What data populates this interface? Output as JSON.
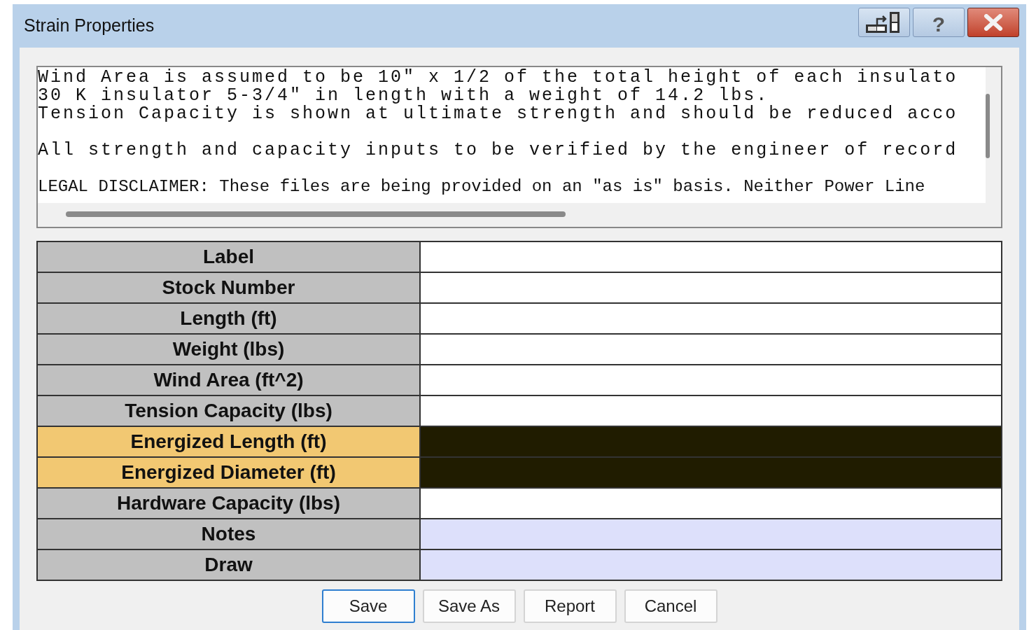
{
  "window": {
    "title": "Strain Properties",
    "help_button": "?"
  },
  "notes": {
    "paragraphs": [
      [
        "Wind Area is assumed to be 10\" x 1/2 of the total height of each insulato",
        "30 K insulator 5-3/4\" in length with a weight of 14.2 lbs.",
        "Tension Capacity is shown at ultimate strength and should be reduced acco"
      ],
      [
        "All strength and capacity inputs to be verified by the engineer of record"
      ],
      [
        "LEGAL DISCLAIMER: These files are being provided on an \"as is\" basis. Neither Power Line"
      ]
    ]
  },
  "properties": [
    {
      "label": "Label",
      "kind": "normal"
    },
    {
      "label": "Stock Number",
      "kind": "normal"
    },
    {
      "label": "Length (ft)",
      "kind": "normal"
    },
    {
      "label": "Weight (lbs)",
      "kind": "normal"
    },
    {
      "label": "Wind Area (ft^2)",
      "kind": "normal"
    },
    {
      "label": "Tension Capacity (lbs)",
      "kind": "normal"
    },
    {
      "label": "Energized Length (ft)",
      "kind": "energized"
    },
    {
      "label": "Energized Diameter (ft)",
      "kind": "energized"
    },
    {
      "label": "Hardware Capacity (lbs)",
      "kind": "normal"
    },
    {
      "label": "Notes",
      "kind": "note"
    },
    {
      "label": "Draw",
      "kind": "note"
    }
  ],
  "buttons": [
    {
      "label": "Save",
      "default": true
    },
    {
      "label": "Save As",
      "default": false
    },
    {
      "label": "Report",
      "default": false
    },
    {
      "label": "Cancel",
      "default": false
    }
  ]
}
